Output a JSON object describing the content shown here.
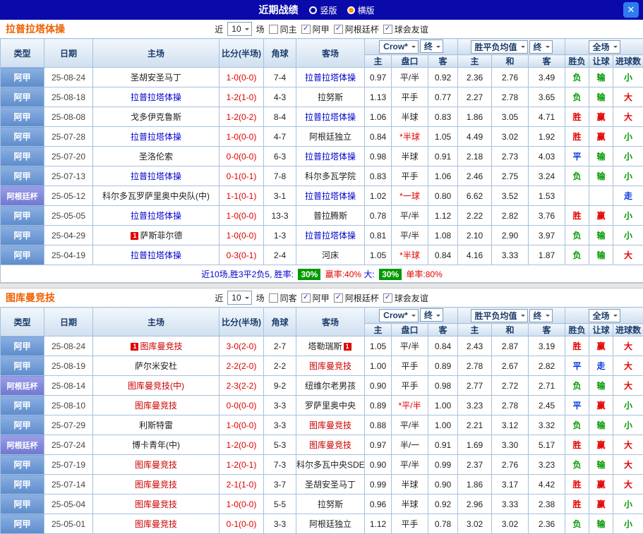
{
  "titlebar": {
    "title": "近期战绩",
    "layout_options": [
      {
        "label": "竖版",
        "selected": false
      },
      {
        "label": "横版",
        "selected": true
      }
    ],
    "close_label": "✕"
  },
  "icons": {
    "check": "✓",
    "chevron_down": "▼",
    "close": "✕",
    "red_card_badge": "1"
  },
  "colors": {
    "win": "#e60000",
    "draw": "#0033dd",
    "lose": "#009900",
    "badge_green": "#009900",
    "accent": "#f06000",
    "score_red": "#dd0000",
    "topbar_bg": "#0a0aaa",
    "league_jia": "#5d8ccb",
    "league_cup": "#7176d0",
    "section1_team_highlight": "#0000cc",
    "section2_team_highlight": "#cc0000"
  },
  "filter_words": {
    "near": "近",
    "count": "10",
    "games": "场"
  },
  "header": {
    "type": "类型",
    "date": "日期",
    "home": "主场",
    "score": "比分(半场)",
    "corner": "角球",
    "away": "客场",
    "ah_provider": "Crow*",
    "stage": "终",
    "euro_label": "胜平负均值",
    "scope": "全场",
    "sub": {
      "h": "主",
      "line": "盘口",
      "a": "客",
      "eh": "主",
      "ed": "和",
      "ea": "客",
      "wdl": "胜负",
      "handicap": "让球",
      "goals": "进球数"
    }
  },
  "sections": [
    {
      "team": "拉普拉塔体操",
      "highlight": "#0000cc",
      "same_label": "同主",
      "same_checked": false,
      "leagues": [
        {
          "label": "阿甲",
          "checked": true
        },
        {
          "label": "阿根廷杯",
          "checked": true
        },
        {
          "label": "球会友谊",
          "checked": true
        }
      ],
      "rows": [
        {
          "league": "阿甲",
          "lg": "jia",
          "date": "25-08-24",
          "home": "圣胡安圣马丁",
          "home_hl": false,
          "score": "1-0(0-0)",
          "corners": "7-4",
          "away": "拉普拉塔体操",
          "away_hl": true,
          "ah": [
            "0.97",
            "平/半",
            "0.92"
          ],
          "eu": [
            "2.36",
            "2.76",
            "3.49"
          ],
          "res": [
            [
              "负",
              "green"
            ],
            [
              "输",
              "green"
            ],
            [
              "小",
              "green"
            ]
          ]
        },
        {
          "league": "阿甲",
          "lg": "jia",
          "date": "25-08-18",
          "home": "拉普拉塔体操",
          "home_hl": true,
          "score": "1-2(1-0)",
          "corners": "4-3",
          "away": "拉努斯",
          "away_hl": false,
          "ah": [
            "1.13",
            "平手",
            "0.77"
          ],
          "eu": [
            "2.27",
            "2.78",
            "3.65"
          ],
          "res": [
            [
              "负",
              "green"
            ],
            [
              "输",
              "green"
            ],
            [
              "大",
              "red"
            ]
          ]
        },
        {
          "league": "阿甲",
          "lg": "jia",
          "date": "25-08-08",
          "home": "戈多伊克鲁斯",
          "home_hl": false,
          "score": "1-2(0-2)",
          "corners": "8-4",
          "away": "拉普拉塔体操",
          "away_hl": true,
          "ah": [
            "1.06",
            "半球",
            "0.83"
          ],
          "eu": [
            "1.86",
            "3.05",
            "4.71"
          ],
          "res": [
            [
              "胜",
              "red"
            ],
            [
              "赢",
              "red"
            ],
            [
              "大",
              "red"
            ]
          ]
        },
        {
          "league": "阿甲",
          "lg": "jia",
          "date": "25-07-28",
          "home": "拉普拉塔体操",
          "home_hl": true,
          "score": "1-0(0-0)",
          "corners": "4-7",
          "away": "阿根廷独立",
          "away_hl": false,
          "ah": [
            "0.84",
            "*半球",
            "1.05"
          ],
          "eu": [
            "4.49",
            "3.02",
            "1.92"
          ],
          "res": [
            [
              "胜",
              "red"
            ],
            [
              "赢",
              "red"
            ],
            [
              "小",
              "green"
            ]
          ]
        },
        {
          "league": "阿甲",
          "lg": "jia",
          "date": "25-07-20",
          "home": "圣洛伦索",
          "home_hl": false,
          "score": "0-0(0-0)",
          "corners": "6-3",
          "away": "拉普拉塔体操",
          "away_hl": true,
          "ah": [
            "0.98",
            "半球",
            "0.91"
          ],
          "eu": [
            "2.18",
            "2.73",
            "4.03"
          ],
          "res": [
            [
              "平",
              "blue"
            ],
            [
              "输",
              "green"
            ],
            [
              "小",
              "green"
            ]
          ]
        },
        {
          "league": "阿甲",
          "lg": "jia",
          "date": "25-07-13",
          "home": "拉普拉塔体操",
          "home_hl": true,
          "score": "0-1(0-1)",
          "corners": "7-8",
          "away": "科尔多瓦学院",
          "away_hl": false,
          "ah": [
            "0.83",
            "平手",
            "1.06"
          ],
          "eu": [
            "2.46",
            "2.75",
            "3.24"
          ],
          "res": [
            [
              "负",
              "green"
            ],
            [
              "输",
              "green"
            ],
            [
              "小",
              "green"
            ]
          ]
        },
        {
          "league": "阿根廷杯",
          "lg": "cup",
          "date": "25-05-12",
          "home": "科尔多瓦罗萨里奥中央队(中)",
          "home_hl": false,
          "score": "1-1(0-1)",
          "corners": "3-1",
          "away": "拉普拉塔体操",
          "away_hl": true,
          "ah": [
            "1.02",
            "*一球",
            "0.80"
          ],
          "eu": [
            "6.62",
            "3.52",
            "1.53"
          ],
          "res": [
            [
              "",
              ""
            ],
            [
              "",
              ""
            ],
            [
              "走",
              "blue"
            ]
          ]
        },
        {
          "league": "阿甲",
          "lg": "jia",
          "date": "25-05-05",
          "home": "拉普拉塔体操",
          "home_hl": true,
          "score": "1-0(0-0)",
          "corners": "13-3",
          "away": "普拉腾斯",
          "away_hl": false,
          "ah": [
            "0.78",
            "平/半",
            "1.12"
          ],
          "eu": [
            "2.22",
            "2.82",
            "3.76"
          ],
          "res": [
            [
              "胜",
              "red"
            ],
            [
              "赢",
              "red"
            ],
            [
              "小",
              "green"
            ]
          ]
        },
        {
          "league": "阿甲",
          "lg": "jia",
          "date": "25-04-29",
          "home": "萨斯菲尔德",
          "home_hl": false,
          "home_card": "1",
          "home_card_pos": "pre",
          "score": "1-0(0-0)",
          "corners": "1-3",
          "away": "拉普拉塔体操",
          "away_hl": true,
          "ah": [
            "0.81",
            "平/半",
            "1.08"
          ],
          "eu": [
            "2.10",
            "2.90",
            "3.97"
          ],
          "res": [
            [
              "负",
              "green"
            ],
            [
              "输",
              "green"
            ],
            [
              "小",
              "green"
            ]
          ]
        },
        {
          "league": "阿甲",
          "lg": "jia",
          "date": "25-04-19",
          "home": "拉普拉塔体操",
          "home_hl": true,
          "score": "0-3(0-1)",
          "corners": "2-4",
          "away": "河床",
          "away_hl": false,
          "ah": [
            "1.05",
            "*半球",
            "0.84"
          ],
          "eu": [
            "4.16",
            "3.33",
            "1.87"
          ],
          "res": [
            [
              "负",
              "green"
            ],
            [
              "输",
              "green"
            ],
            [
              "大",
              "red"
            ]
          ]
        }
      ],
      "summary": {
        "parts": [
          {
            "t": "近10场,胜3平2负5, 胜率: ",
            "s": "blue"
          },
          {
            "t": "30%",
            "s": "badge"
          },
          {
            "t": " 赢率:40% ",
            "s": "red"
          },
          {
            "t": "大: ",
            "s": "blue"
          },
          {
            "t": "30%",
            "s": "badge"
          },
          {
            "t": " 单率:80%",
            "s": "red"
          }
        ]
      }
    },
    {
      "team": "图库曼竞技",
      "highlight": "#cc0000",
      "same_label": "同客",
      "same_checked": false,
      "leagues": [
        {
          "label": "阿甲",
          "checked": true
        },
        {
          "label": "阿根廷杯",
          "checked": true
        },
        {
          "label": "球会友谊",
          "checked": true
        }
      ],
      "rows": [
        {
          "league": "阿甲",
          "lg": "jia",
          "date": "25-08-24",
          "home": "图库曼竞技",
          "home_hl": true,
          "home_card": "1",
          "home_card_pos": "pre",
          "score": "3-0(2-0)",
          "corners": "2-7",
          "away": "塔勒瑞斯",
          "away_hl": false,
          "away_card": "1",
          "away_card_pos": "post",
          "ah": [
            "1.05",
            "平/半",
            "0.84"
          ],
          "eu": [
            "2.43",
            "2.87",
            "3.19"
          ],
          "res": [
            [
              "胜",
              "red"
            ],
            [
              "赢",
              "red"
            ],
            [
              "大",
              "red"
            ]
          ]
        },
        {
          "league": "阿甲",
          "lg": "jia",
          "date": "25-08-19",
          "home": "萨尔米安杜",
          "home_hl": false,
          "score": "2-2(2-0)",
          "corners": "2-2",
          "away": "图库曼竞技",
          "away_hl": true,
          "ah": [
            "1.00",
            "平手",
            "0.89"
          ],
          "eu": [
            "2.78",
            "2.67",
            "2.82"
          ],
          "res": [
            [
              "平",
              "blue"
            ],
            [
              "走",
              "blue"
            ],
            [
              "大",
              "red"
            ]
          ]
        },
        {
          "league": "阿根廷杯",
          "lg": "cup",
          "date": "25-08-14",
          "home": "图库曼竞技(中)",
          "home_hl": true,
          "score": "2-3(2-2)",
          "corners": "9-2",
          "away": "纽维尔老男孩",
          "away_hl": false,
          "ah": [
            "0.90",
            "平手",
            "0.98"
          ],
          "eu": [
            "2.77",
            "2.72",
            "2.71"
          ],
          "res": [
            [
              "负",
              "green"
            ],
            [
              "输",
              "green"
            ],
            [
              "大",
              "red"
            ]
          ]
        },
        {
          "league": "阿甲",
          "lg": "jia",
          "date": "25-08-10",
          "home": "图库曼竞技",
          "home_hl": true,
          "score": "0-0(0-0)",
          "corners": "3-3",
          "away": "罗萨里奥中央",
          "away_hl": false,
          "ah": [
            "0.89",
            "*平/半",
            "1.00"
          ],
          "eu": [
            "3.23",
            "2.78",
            "2.45"
          ],
          "res": [
            [
              "平",
              "blue"
            ],
            [
              "赢",
              "red"
            ],
            [
              "小",
              "green"
            ]
          ]
        },
        {
          "league": "阿甲",
          "lg": "jia",
          "date": "25-07-29",
          "home": "利斯特雷",
          "home_hl": false,
          "score": "1-0(0-0)",
          "corners": "3-3",
          "away": "图库曼竞技",
          "away_hl": true,
          "ah": [
            "0.88",
            "平/半",
            "1.00"
          ],
          "eu": [
            "2.21",
            "3.12",
            "3.32"
          ],
          "res": [
            [
              "负",
              "green"
            ],
            [
              "输",
              "green"
            ],
            [
              "小",
              "green"
            ]
          ]
        },
        {
          "league": "阿根廷杯",
          "lg": "cup",
          "date": "25-07-24",
          "home": "博卡青年(中)",
          "home_hl": false,
          "score": "1-2(0-0)",
          "corners": "5-3",
          "away": "图库曼竞技",
          "away_hl": true,
          "ah": [
            "0.97",
            "半/一",
            "0.91"
          ],
          "eu": [
            "1.69",
            "3.30",
            "5.17"
          ],
          "res": [
            [
              "胜",
              "red"
            ],
            [
              "赢",
              "red"
            ],
            [
              "大",
              "red"
            ]
          ]
        },
        {
          "league": "阿甲",
          "lg": "jia",
          "date": "25-07-19",
          "home": "图库曼竞技",
          "home_hl": true,
          "score": "1-2(0-1)",
          "corners": "7-3",
          "away": "科尔多瓦中央SDE",
          "away_hl": false,
          "ah": [
            "0.90",
            "平/半",
            "0.99"
          ],
          "eu": [
            "2.37",
            "2.76",
            "3.23"
          ],
          "res": [
            [
              "负",
              "green"
            ],
            [
              "输",
              "green"
            ],
            [
              "大",
              "red"
            ]
          ]
        },
        {
          "league": "阿甲",
          "lg": "jia",
          "date": "25-07-14",
          "home": "图库曼竞技",
          "home_hl": true,
          "score": "2-1(1-0)",
          "corners": "3-7",
          "away": "圣胡安圣马丁",
          "away_hl": false,
          "ah": [
            "0.99",
            "半球",
            "0.90"
          ],
          "eu": [
            "1.86",
            "3.17",
            "4.42"
          ],
          "res": [
            [
              "胜",
              "red"
            ],
            [
              "赢",
              "red"
            ],
            [
              "大",
              "red"
            ]
          ]
        },
        {
          "league": "阿甲",
          "lg": "jia",
          "date": "25-05-04",
          "home": "图库曼竞技",
          "home_hl": true,
          "score": "1-0(0-0)",
          "corners": "5-5",
          "away": "拉努斯",
          "away_hl": false,
          "ah": [
            "0.96",
            "半球",
            "0.92"
          ],
          "eu": [
            "2.96",
            "3.33",
            "2.38"
          ],
          "res": [
            [
              "胜",
              "red"
            ],
            [
              "赢",
              "red"
            ],
            [
              "小",
              "green"
            ]
          ]
        },
        {
          "league": "阿甲",
          "lg": "jia",
          "date": "25-05-01",
          "home": "图库曼竞技",
          "home_hl": true,
          "score": "0-1(0-0)",
          "corners": "3-3",
          "away": "阿根廷独立",
          "away_hl": false,
          "ah": [
            "1.12",
            "平手",
            "0.78"
          ],
          "eu": [
            "3.02",
            "3.02",
            "2.36"
          ],
          "res": [
            [
              "负",
              "green"
            ],
            [
              "输",
              "green"
            ],
            [
              "小",
              "green"
            ]
          ]
        }
      ],
      "summary": null
    }
  ]
}
